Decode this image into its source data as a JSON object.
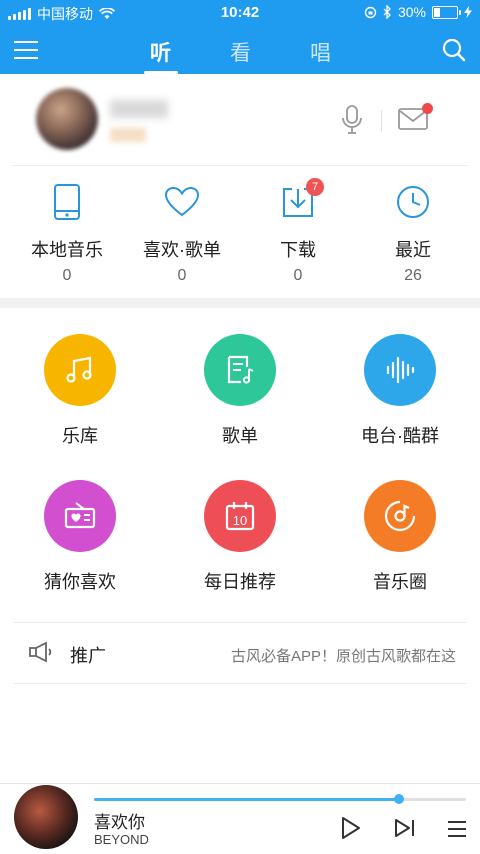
{
  "status_bar": {
    "carrier": "中国移动",
    "time": "10:42",
    "battery": "30%",
    "battery_level": 0.3
  },
  "nav": {
    "tabs": [
      "听",
      "看",
      "唱"
    ],
    "active_tab": "听"
  },
  "profile": {
    "icons": [
      "mic-icon",
      "mail-icon"
    ]
  },
  "stats": [
    {
      "label": "本地音乐",
      "count": "0",
      "icon": "phone-icon"
    },
    {
      "label": "喜欢·歌单",
      "count": "0",
      "icon": "heart-icon"
    },
    {
      "label": "下载",
      "count": "0",
      "icon": "download-icon",
      "badge": "7"
    },
    {
      "label": "最近",
      "count": "26",
      "icon": "clock-icon"
    }
  ],
  "grid": [
    {
      "label": "乐库",
      "color": "#f7b500",
      "icon": "music-note-icon"
    },
    {
      "label": "歌单",
      "color": "#2ec79a",
      "icon": "playlist-icon"
    },
    {
      "label": "电台·酷群",
      "color": "#2ea7ea",
      "icon": "waveform-icon"
    },
    {
      "label": "猜你喜欢",
      "color": "#d24fd0",
      "icon": "radio-heart-icon"
    },
    {
      "label": "每日推荐",
      "color": "#ee4f57",
      "icon": "calendar-icon",
      "day": "10"
    },
    {
      "label": "音乐圈",
      "color": "#f57c26",
      "icon": "disc-icon"
    }
  ],
  "promo": {
    "title": "推广",
    "text": "古风必备APP！原创古风歌都在这"
  },
  "player": {
    "song": "喜欢你",
    "artist": "BEYOND",
    "progress": 0.82
  },
  "colors": {
    "header": "#1f9bf0",
    "accent": "#3fb3f2",
    "badge": "#f05353"
  }
}
